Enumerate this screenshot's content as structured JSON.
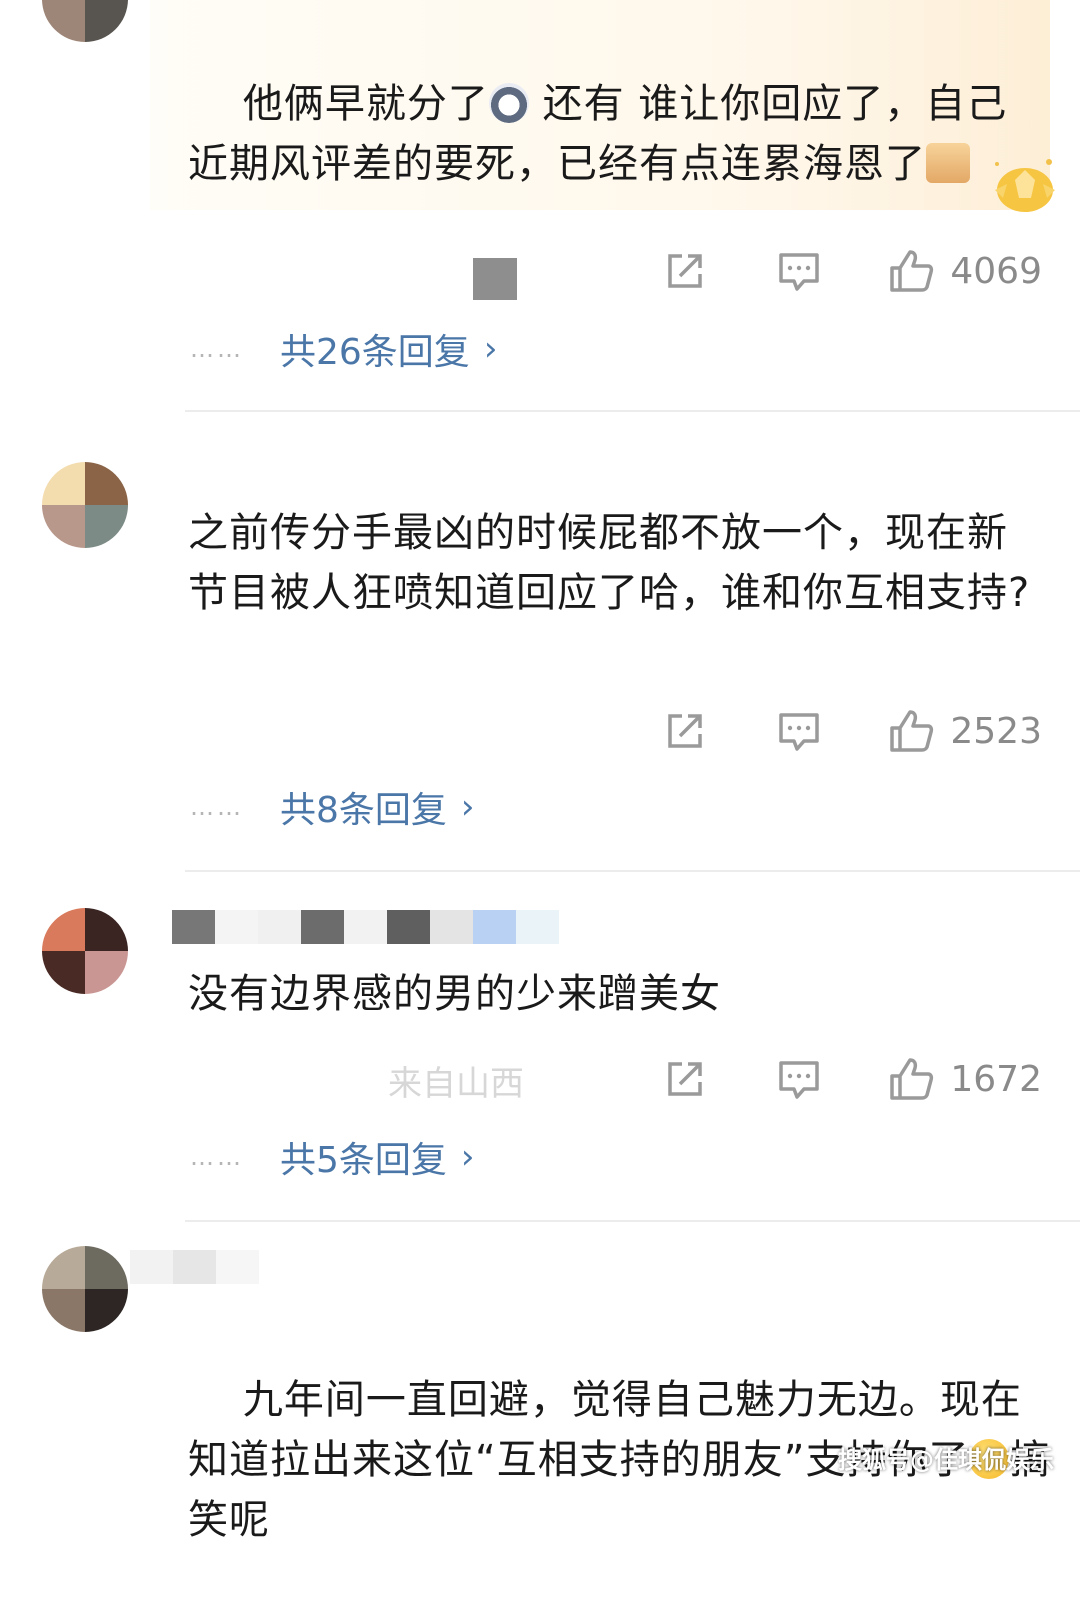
{
  "comments": [
    {
      "text_before_emoji": "他俩早就分了",
      "text_after_emoji": " 还有 谁让你回应了，自己近期风评差的要死，已经有点连累海恩了",
      "emoji_1": "husky-emoji",
      "emoji_2": "pray-emoji",
      "like_count": "4069",
      "reply_text": "共26条回复"
    },
    {
      "text": "之前传分手最凶的时候屁都不放一个，现在新节目被人狂喷知道回应了哈，谁和你互相支持?",
      "like_count": "2523",
      "reply_text": "共8条回复"
    },
    {
      "text": "没有边界感的男的少来蹭美女",
      "meta": "来自山西",
      "like_count": "1672",
      "reply_text": "共5条回复"
    },
    {
      "text_before_emoji": "九年间一直回避，觉得自己魅力无边。现在知道拉出来这位“互相支持的朋友”支持你了",
      "text_after_emoji": "搞笑呢",
      "emoji": "thinking-face-emoji"
    }
  ],
  "reply_chevron": "›",
  "dots": "……",
  "watermark": "搜狐号@佳琪侃娱乐",
  "colors": {
    "reply_link": "#4a76a8",
    "like_count": "#8a8a8a",
    "divider": "#ececec"
  },
  "icons": [
    "share-icon",
    "comment-icon",
    "like-icon"
  ]
}
